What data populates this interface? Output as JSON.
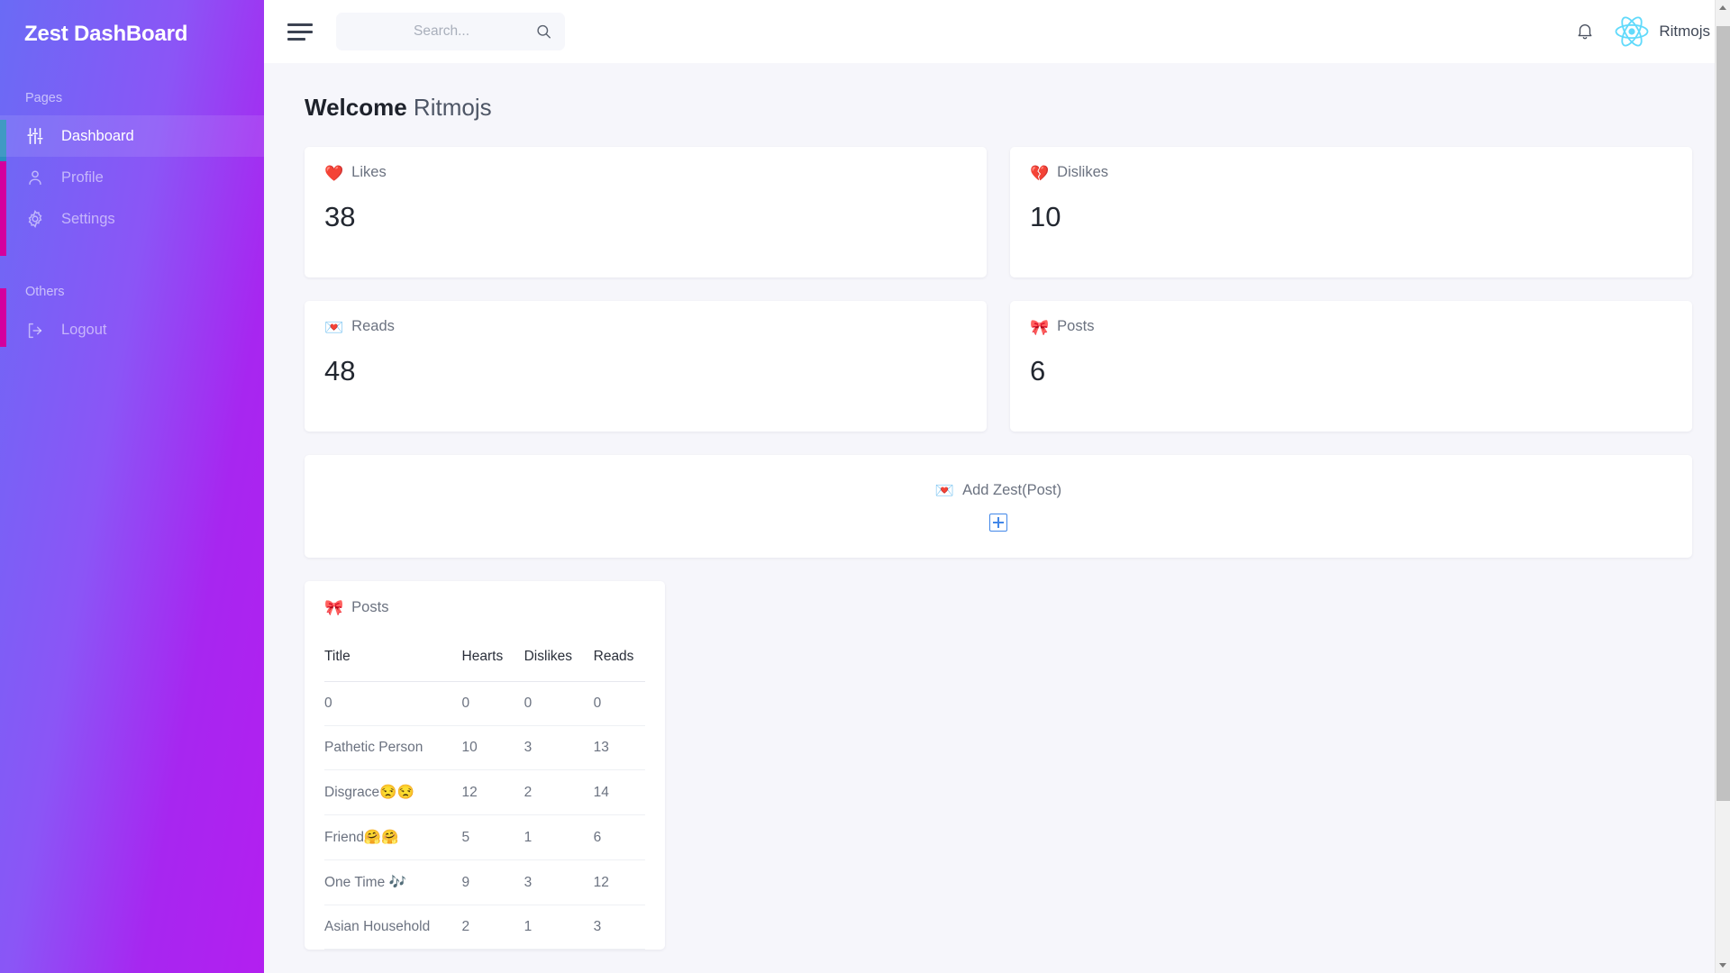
{
  "sidebar": {
    "brand": "Zest DashBoard",
    "sections": [
      {
        "label": "Pages",
        "items": [
          {
            "label": "Dashboard",
            "icon": "sliders-icon",
            "active": true
          },
          {
            "label": "Profile",
            "icon": "user-icon",
            "active": false
          },
          {
            "label": "Settings",
            "icon": "gear-icon",
            "active": false
          }
        ]
      },
      {
        "label": "Others",
        "items": [
          {
            "label": "Logout",
            "icon": "logout-icon",
            "active": false
          }
        ]
      }
    ]
  },
  "topbar": {
    "menu_icon": "hamburger-icon",
    "search": {
      "value": "",
      "placeholder": "Search...",
      "icon": "search-icon"
    },
    "notification_icon": "bell-icon",
    "user": {
      "name": "Ritmojs",
      "avatar_icon": "react-logo-icon"
    }
  },
  "main": {
    "welcome_prefix": "Welcome",
    "welcome_name": "Ritmojs",
    "stats": [
      {
        "emoji": "❤️",
        "emoji_name": "red-heart-emoji",
        "label": "Likes",
        "value": "38"
      },
      {
        "emoji": "💔",
        "emoji_name": "broken-heart-emoji",
        "label": "Dislikes",
        "value": "10"
      },
      {
        "emoji": "💌",
        "emoji_name": "love-letter-emoji",
        "label": "Reads",
        "value": "48"
      },
      {
        "emoji": "🎀",
        "emoji_name": "ribbon-emoji",
        "label": "Posts",
        "value": "6"
      }
    ],
    "add_card": {
      "emoji": "💌",
      "emoji_name": "love-letter-emoji",
      "label": "Add Zest(Post)",
      "plus_icon": "plus-square-icon"
    },
    "posts_table": {
      "emoji": "🎀",
      "emoji_name": "ribbon-emoji",
      "title": "Posts",
      "columns": [
        "Title",
        "Hearts",
        "Dislikes",
        "Reads"
      ],
      "rows": [
        {
          "title": "0",
          "hearts": "0",
          "dislikes": "0",
          "reads": "0"
        },
        {
          "title": "Pathetic Person",
          "hearts": "10",
          "dislikes": "3",
          "reads": "13"
        },
        {
          "title": "Disgrace😒😒",
          "hearts": "12",
          "dislikes": "2",
          "reads": "14"
        },
        {
          "title": "Friend🤗🤗",
          "hearts": "5",
          "dislikes": "1",
          "reads": "6"
        },
        {
          "title": "One Time 🎶",
          "hearts": "9",
          "dislikes": "3",
          "reads": "12"
        },
        {
          "title": "Asian Household",
          "hearts": "2",
          "dislikes": "1",
          "reads": "3"
        }
      ]
    }
  },
  "colors": {
    "sidebar_start": "#6a6bf5",
    "sidebar_end": "#b31ff0",
    "active_marker": "#2b8fbd",
    "inactive_marker": "#d4009e",
    "accent_blue": "#4287e8",
    "react_cyan": "#61dafb",
    "page_bg": "#f6f6fb"
  }
}
